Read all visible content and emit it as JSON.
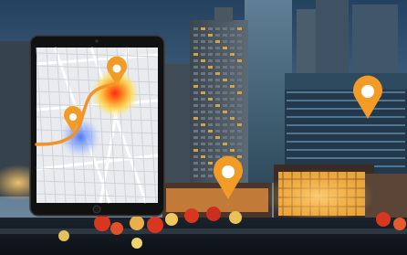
{
  "scene": {
    "subject": "city-skyline-at-dusk-with-tablet-map-overlay",
    "icons": [
      "map-pin-icon",
      "tablet-icon",
      "heatmap-blob"
    ],
    "colors": {
      "sky_top": "#24425f",
      "sky_bottom": "#6e8aa3",
      "pin": "#f29b26",
      "route": "#f39229",
      "tablet_frame": "#111111",
      "map_bg": "#e9ebee",
      "window_warm": "#ffc85a",
      "foliage_red": "#d9361f"
    }
  }
}
